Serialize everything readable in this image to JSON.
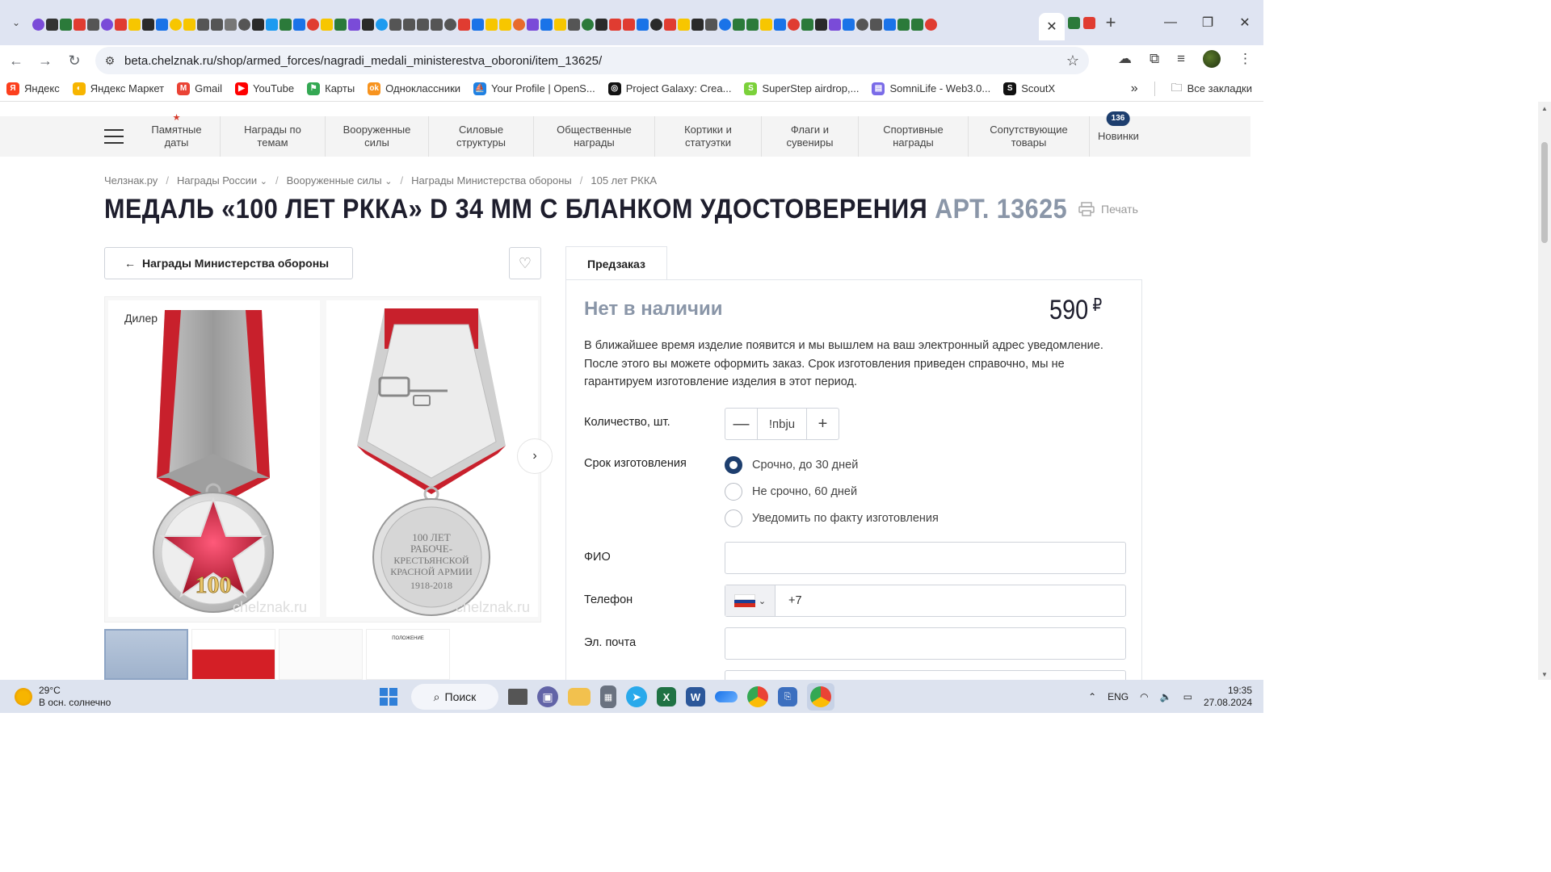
{
  "browser": {
    "active_tab_close": "✕",
    "new_tab": "+",
    "url": "beta.chelznak.ru/shop/armed_forces/nagradi_medali_ministerestva_oboroni/item_13625/",
    "tab_favicon_colors": [
      "#7a4bd8",
      "#333",
      "#2b7a3a",
      "#e03c31",
      "#555",
      "#7a4bd8",
      "#e03c31",
      "#f7c600",
      "#2a2a2a",
      "#1a73e8",
      "#f7c600",
      "#f7c600",
      "#555",
      "#555",
      "#777",
      "#555",
      "#2a2a2a",
      "#1d9bf0",
      "#2b7a3a",
      "#1a73e8",
      "#e03c31",
      "#f7c600",
      "#2b7a3a",
      "#7a4bd8",
      "#2a2a2a",
      "#1d9bf0",
      "#555",
      "#555",
      "#555",
      "#555",
      "#555",
      "#e03c31",
      "#1a73e8",
      "#f7c600",
      "#f7c600",
      "#e86b2b",
      "#7a4bd8",
      "#1a73e8",
      "#f7c600",
      "#555",
      "#2b7a3a",
      "#2a2a2a",
      "#e03c31",
      "#e03c31",
      "#1a73e8",
      "#2a2a2a",
      "#e03c31",
      "#f7c600",
      "#2a2a2a",
      "#555",
      "#1a73e8",
      "#2b7a3a",
      "#2b7a3a",
      "#f7c600",
      "#1a73e8",
      "#e03c31",
      "#2b7a3a",
      "#2a2a2a",
      "#7a4bd8",
      "#1a73e8",
      "#555",
      "#555",
      "#1a73e8",
      "#2b7a3a",
      "#2b7a3a",
      "#e03c31"
    ]
  },
  "bookmarks": {
    "items": [
      {
        "label": "Яндекс",
        "icon": "yandex-icon",
        "color": "#fc3f1d",
        "glyph": "Я"
      },
      {
        "label": "Яндекс Маркет",
        "icon": "yandex-market-icon",
        "color": "#f7b500",
        "glyph": "◐"
      },
      {
        "label": "Gmail",
        "icon": "gmail-icon",
        "color": "#ea4335",
        "glyph": "M"
      },
      {
        "label": "YouTube",
        "icon": "youtube-icon",
        "color": "#ff0000",
        "glyph": "▶"
      },
      {
        "label": "Карты",
        "icon": "maps-icon",
        "color": "#34a853",
        "glyph": "⚑"
      },
      {
        "label": "Одноклассники",
        "icon": "ok-icon",
        "color": "#f7931e",
        "glyph": "ok"
      },
      {
        "label": "Your Profile | OpenS...",
        "icon": "opensea-icon",
        "color": "#2081e2",
        "glyph": "⛵"
      },
      {
        "label": "Project Galaxy: Crea...",
        "icon": "galaxy-icon",
        "color": "#111111",
        "glyph": "◎"
      },
      {
        "label": "SuperStep airdrop,...",
        "icon": "superstep-icon",
        "color": "#7bd13a",
        "glyph": "S"
      },
      {
        "label": "SomniLife - Web3.0...",
        "icon": "somnilife-icon",
        "color": "#7a6be8",
        "glyph": "▤"
      },
      {
        "label": "ScoutX",
        "icon": "scoutx-icon",
        "color": "#111111",
        "glyph": "S"
      }
    ],
    "more": "»",
    "all_bookmarks": "Все закладки"
  },
  "site_menu": {
    "items": [
      {
        "label": "Памятные даты",
        "name": "memorial-dates",
        "width": 108,
        "star": true
      },
      {
        "label": "Награды по темам",
        "name": "awards-by-theme",
        "width": 130
      },
      {
        "label": "Вооруженные силы",
        "name": "armed-forces",
        "width": 128
      },
      {
        "label": "Силовые структуры",
        "name": "security-structures",
        "width": 130
      },
      {
        "label": "Общественные награды",
        "name": "public-awards",
        "width": 150
      },
      {
        "label": "Кортики и статуэтки",
        "name": "daggers-figurines",
        "width": 132
      },
      {
        "label": "Флаги и сувениры",
        "name": "flags-souvenirs",
        "width": 120
      },
      {
        "label": "Спортивные награды",
        "name": "sport-awards",
        "width": 136
      },
      {
        "label": "Сопутствующие товары",
        "name": "related-goods",
        "width": 150
      },
      {
        "label": "Новинки",
        "name": "new-items",
        "width": 70,
        "badge": "136"
      }
    ]
  },
  "breadcrumbs": [
    {
      "label": "Челзнак.ру"
    },
    {
      "label": "Награды России",
      "dropdown": true
    },
    {
      "label": "Вооруженные силы",
      "dropdown": true
    },
    {
      "label": "Награды Министерства обороны"
    },
    {
      "label": "105 лет РККА"
    }
  ],
  "product": {
    "title": "МЕДАЛЬ «100 ЛЕТ РККА» D 34 ММ С БЛАНКОМ УДОСТОВЕРЕНИЯ",
    "article": "АРТ. 13625",
    "print_label": "Печать",
    "back_label": "Награды Министерства обороны",
    "dealer_label": "Дилер",
    "watermark": "chelznak.ru",
    "medal_front_text": "100",
    "medal_back_text": "100 ЛЕТ РАБОЧЕ-КРЕСТЬЯНСКОЙ КРАСНОЙ АРМИИ 1918-2018",
    "thumb_doc_title": "ПОЛОЖЕНИЕ"
  },
  "order": {
    "tab_label": "Предзаказ",
    "stock_status": "Нет в наличии",
    "price": "590",
    "currency": "₽",
    "notice": "В ближайшее время изделие появится и мы вышлем на ваш электронный адрес уведомление. После этого вы можете оформить заказ. Срок изготовления приведен справочно, мы не гарантируем изготовление изделия в этот период.",
    "qty_label": "Количество, шт.",
    "qty_value": "!пbju",
    "term_label": "Срок изготовления",
    "term_options": [
      {
        "label": "Срочно, до 30 дней",
        "selected": true
      },
      {
        "label": "Не срочно, 60 дней",
        "selected": false
      },
      {
        "label": "Уведомить по факту изготовления",
        "selected": false
      }
    ],
    "name_label": "ФИО",
    "phone_label": "Телефон",
    "phone_value": "+7",
    "email_label": "Эл. почта"
  },
  "taskbar": {
    "temperature": "29°C",
    "weather": "В осн. солнечно",
    "search_label": "Поиск",
    "language": "ENG",
    "time": "19:35",
    "date": "27.08.2024"
  }
}
